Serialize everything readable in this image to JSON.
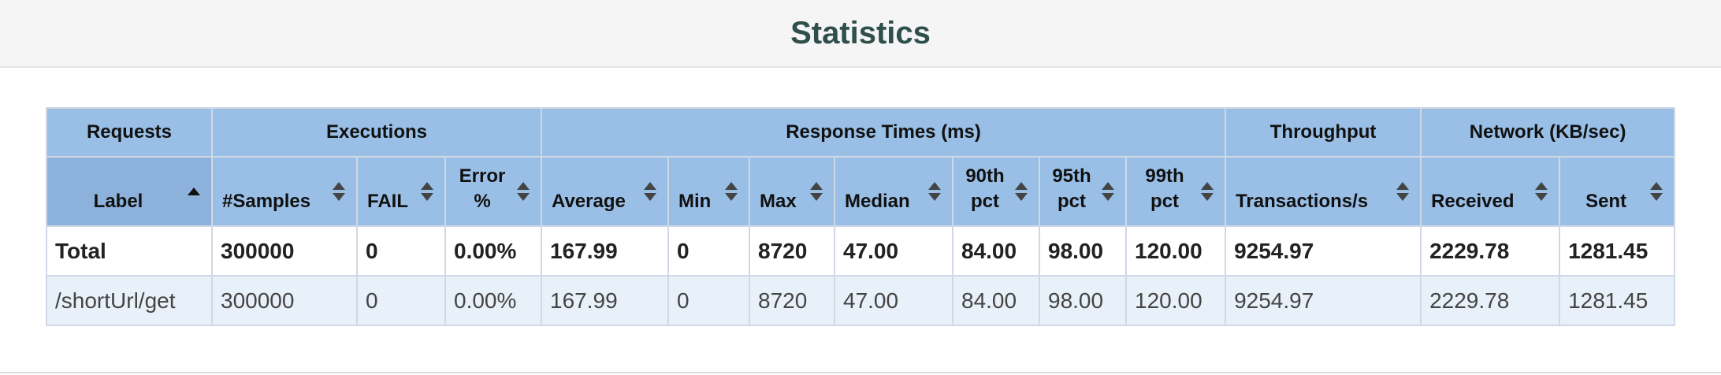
{
  "page": {
    "title": "Statistics"
  },
  "groups": {
    "requests": "Requests",
    "executions": "Executions",
    "response_times": "Response Times (ms)",
    "throughput": "Throughput",
    "network": "Network (KB/sec)"
  },
  "columns": {
    "label": "Label",
    "samples": "#Samples",
    "fail": "FAIL",
    "error_pct": "Error %",
    "average": "Average",
    "min": "Min",
    "max": "Max",
    "median": "Median",
    "p90": "90th pct",
    "p95": "95th pct",
    "p99": "99th pct",
    "transactions": "Transactions/s",
    "received": "Received",
    "sent": "Sent"
  },
  "sort": {
    "column": "label",
    "direction": "ascending"
  },
  "rows": [
    {
      "label": "Total",
      "samples": "300000",
      "fail": "0",
      "error_pct": "0.00%",
      "average": "167.99",
      "min": "0",
      "max": "8720",
      "median": "47.00",
      "p90": "84.00",
      "p95": "98.00",
      "p99": "120.00",
      "transactions": "9254.97",
      "received": "2229.78",
      "sent": "1281.45"
    },
    {
      "label": "/shortUrl/get",
      "samples": "300000",
      "fail": "0",
      "error_pct": "0.00%",
      "average": "167.99",
      "min": "0",
      "max": "8720",
      "median": "47.00",
      "p90": "84.00",
      "p95": "98.00",
      "p99": "120.00",
      "transactions": "9254.97",
      "received": "2229.78",
      "sent": "1281.45"
    }
  ]
}
